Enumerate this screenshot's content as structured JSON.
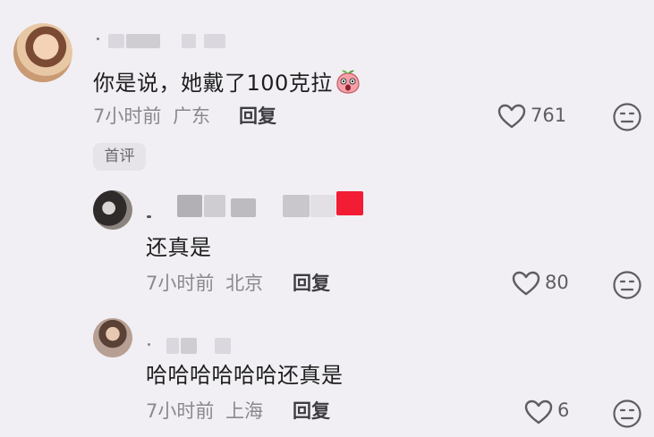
{
  "comments": [
    {
      "content": "你是说，她戴了100克拉",
      "time": "7小时前",
      "location": "广东",
      "reply_label": "回复",
      "likes": "761",
      "tag": "首评"
    },
    {
      "content": "还真是",
      "time": "7小时前",
      "location": "北京",
      "reply_label": "回复",
      "likes": "80"
    },
    {
      "content": "哈哈哈哈哈哈还真是",
      "time": "7小时前",
      "location": "上海",
      "reply_label": "回复",
      "likes": "6"
    }
  ],
  "colors": {
    "background": "#f1eff4",
    "accent_red": "#f21c34",
    "meta_text": "#8a888d"
  },
  "icons": {
    "like": "heart-outline-icon",
    "dislike": "neutral-face-icon",
    "emoji": "surprised-peach-emoji"
  }
}
